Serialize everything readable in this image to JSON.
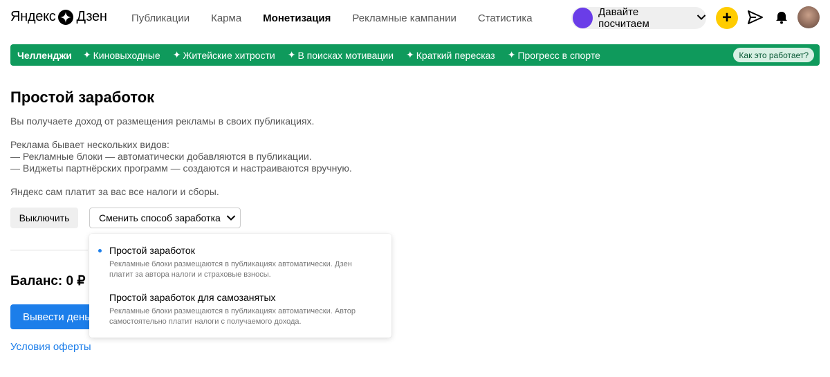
{
  "header": {
    "logo": {
      "part1": "Яндекс",
      "part2": "Дзен"
    },
    "nav": [
      "Публикации",
      "Карма",
      "Монетизация",
      "Рекламные кампании",
      "Статистика"
    ],
    "active_nav": "Монетизация",
    "channel_name": "Давайте посчитаем"
  },
  "strip": {
    "title": "Челленджи",
    "items": [
      "Киновыходные",
      "Житейские хитрости",
      "В поисках мотивации",
      "Краткий пересказ",
      "Прогресс в спорте"
    ],
    "how_label": "Как это работает?"
  },
  "main": {
    "title": "Простой заработок",
    "intro": "Вы получаете доход от размещения рекламы в своих публикациях.",
    "types_heading": "Реклама бывает нескольких видов:",
    "type1": "— Рекламные блоки — автоматически добавляются в публикации.",
    "type2": "— Виджеты партнёрских программ — создаются и настраиваются вручную.",
    "taxes": "Яндекс сам платит за вас все налоги и сборы.",
    "off_label": "Выключить",
    "change_label": "Сменить способ заработка",
    "balance": "Баланс: 0 ₽",
    "withdraw_label": "Вывести деньги",
    "offer_label": "Условия оферты"
  },
  "dropdown": {
    "options": [
      {
        "title": "Простой заработок",
        "desc1": "Рекламные блоки размещаются в публикациях автоматически. Дзен",
        "desc2": "платит за автора налоги и страховые взносы.",
        "selected": true
      },
      {
        "title": "Простой заработок для самозанятых",
        "desc1": "Рекламные блоки размещаются в публикациях автоматически. Автор",
        "desc2": "самостоятельно платит налоги с получаемого дохода.",
        "selected": false
      }
    ]
  },
  "colors": {
    "accent_blue": "#1c7eea",
    "strip_green": "#0f9a5c",
    "plus_yellow": "#ffcc00"
  },
  "icons": [
    "zen-logo-icon",
    "chevron-down-icon",
    "plus-icon",
    "send-icon",
    "bell-icon",
    "sparkle-icon",
    "bullet-dot-icon"
  ]
}
